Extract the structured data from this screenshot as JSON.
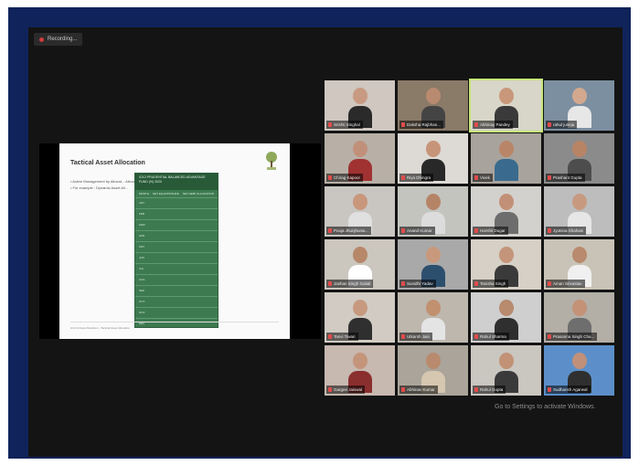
{
  "recording": {
    "label": "Recording..."
  },
  "slide": {
    "title": "Tactical Asset Allocation",
    "bullets": [
      "•  Active Management by Allocat...                                                        Allocation, Valuations and other factors",
      "•  For example : Dynamic Asset All..."
    ],
    "table": {
      "header": "ICICI PRUDENTIAL BALANCED ADVANTAGE FUND (%) 2020",
      "columns": [
        "MONTH",
        "NET EQ EXPOSURE",
        "NET DEBT ALLOCATION"
      ],
      "rows": [
        [
          "JAN",
          "",
          "",
          ""
        ],
        [
          "FEB",
          "",
          ""
        ],
        [
          "MAR",
          "",
          ""
        ],
        [
          "APR",
          "",
          ""
        ],
        [
          "MAY",
          "",
          ""
        ],
        [
          "JUN",
          "",
          ""
        ],
        [
          "JUL",
          "",
          ""
        ],
        [
          "AUG",
          "",
          ""
        ],
        [
          "SEP",
          "",
          ""
        ],
        [
          "OCT",
          "",
          ""
        ],
        [
          "NOV",
          "",
          ""
        ],
        [
          "DEC",
          "",
          ""
        ]
      ]
    },
    "footer": "Unit III Asset Allocation - Tactical Asset Allocation"
  },
  "participants": [
    {
      "name": "Srishti Singhal",
      "skin": "#c89a82",
      "shirt": "#2a2a2a",
      "bg": "#cfc7c0"
    },
    {
      "name": "Daksha Rajbhan...",
      "skin": "#b88a70",
      "shirt": "#444",
      "bg": "#8a7a68"
    },
    {
      "name": "Abhinay Pandey",
      "skin": "#c9977a",
      "shirt": "#3a3a3a",
      "bg": "#d8d6c8",
      "active": true
    },
    {
      "name": "rahul juneja",
      "skin": "#d2a98f",
      "shirt": "#e7e7e7",
      "bg": "#7c8fa0"
    },
    {
      "name": "Chirag Kapoor",
      "skin": "#c1907a",
      "shirt": "#a03232",
      "bg": "#b8b0a6"
    },
    {
      "name": "Riya Dhingra",
      "skin": "#c69478",
      "shirt": "#282828",
      "bg": "#ddd9d4"
    },
    {
      "name": "Vivek",
      "skin": "#b98568",
      "shirt": "#3a6b8e",
      "bg": "#a8a39c"
    },
    {
      "name": "Prashant Gupta",
      "skin": "#b88466",
      "shirt": "#4d4d4d",
      "bg": "#8b8b8b"
    },
    {
      "name": "Pooja Jhunjhunw...",
      "skin": "#c8977c",
      "shirt": "#e0e0e0",
      "bg": "#c9c6c2"
    },
    {
      "name": "Anand Kumar",
      "skin": "#b58467",
      "shirt": "#dcdcdc",
      "bg": "#c4c4bf"
    },
    {
      "name": "Harshit Dugar",
      "skin": "#c29077",
      "shirt": "#6d6d6d",
      "bg": "#d3d1cd"
    },
    {
      "name": "Jyotsna Shahani",
      "skin": "#c79a80",
      "shirt": "#e6e6e6",
      "bg": "#bdbdbd"
    },
    {
      "name": "Jashan Singh Gulati",
      "skin": "#b78769",
      "shirt": "#ffffff",
      "bg": "#cbc6be"
    },
    {
      "name": "Sunidhi Yadav",
      "skin": "#c8997d",
      "shirt": "#2d4f6e",
      "bg": "#a9a9a9"
    },
    {
      "name": "Tanisha Singh",
      "skin": "#c4957a",
      "shirt": "#3a3a3a",
      "bg": "#d6d0c6"
    },
    {
      "name": "Aman Srivastav",
      "skin": "#b98a6d",
      "shirt": "#f0f0f0",
      "bg": "#c9c3b7"
    },
    {
      "name": "Tanvi Tiwari",
      "skin": "#c79a7f",
      "shirt": "#2f2f2f",
      "bg": "#d1cbc3"
    },
    {
      "name": "Utkarsh Jain",
      "skin": "#c1916f",
      "shirt": "#e4e4e4",
      "bg": "#bdb7ae"
    },
    {
      "name": "Rahul Sharma",
      "skin": "#b88a6e",
      "shirt": "#2f2f2f",
      "bg": "#cfcfcf"
    },
    {
      "name": "Prasanna Singh Cha...",
      "skin": "#c49277",
      "shirt": "#6e6e6e",
      "bg": "#b3aea6"
    },
    {
      "name": "Gargee Jaiswal",
      "skin": "#c4957a",
      "shirt": "#8a2e2e",
      "bg": "#c7b8b0"
    },
    {
      "name": "Abhinav Kumar",
      "skin": "#b98a6d",
      "shirt": "#d6c7b0",
      "bg": "#aaa49a"
    },
    {
      "name": "Rahul Gupta",
      "skin": "#c29276",
      "shirt": "#3a3a3a",
      "bg": "#cac6c0"
    },
    {
      "name": "Sudhansh Agarwal",
      "skin": "#c0907a",
      "shirt": "#2f2f2f",
      "bg": "#5c8fc9"
    }
  ],
  "watermark": {
    "text": "Go to Settings to activate Windows."
  }
}
